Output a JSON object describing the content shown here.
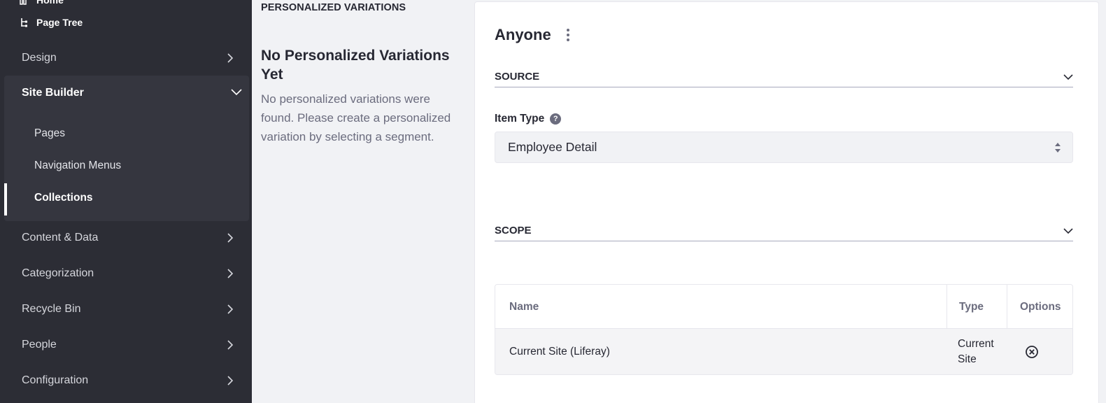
{
  "sidebar": {
    "top_items": [
      {
        "label": "Home",
        "icon": "home-icon"
      },
      {
        "label": "Page Tree",
        "icon": "page-tree-icon"
      }
    ],
    "sections": [
      {
        "label": "Design"
      },
      {
        "label": "Content & Data"
      },
      {
        "label": "Categorization"
      },
      {
        "label": "Recycle Bin"
      },
      {
        "label": "People"
      },
      {
        "label": "Configuration"
      }
    ],
    "expanded": {
      "label": "Site Builder",
      "items": [
        {
          "label": "Pages"
        },
        {
          "label": "Navigation Menus"
        },
        {
          "label": "Collections",
          "active": true
        }
      ]
    }
  },
  "middle": {
    "title": "PERSONALIZED VARIATIONS",
    "heading": "No Personalized Variations Yet",
    "description": "No personalized variations were found. Please create a personalized variation by selecting a segment."
  },
  "panel": {
    "title": "Anyone",
    "source": {
      "label": "SOURCE",
      "item_type_label": "Item Type",
      "item_type_value": "Employee Detail"
    },
    "scope": {
      "label": "SCOPE",
      "table": {
        "headers": [
          "Name",
          "Type",
          "Options"
        ],
        "rows": [
          {
            "name": "Current Site (Liferay)",
            "type": "Current Site"
          }
        ]
      }
    }
  },
  "colors": {
    "sidebar_bg": "#2c2d35",
    "sidebar_expanded_bg": "#35363f",
    "page_bg": "#f1f2f5",
    "panel_bg": "#ffffff",
    "text_primary": "#272833",
    "text_secondary": "#6b6c7e"
  }
}
